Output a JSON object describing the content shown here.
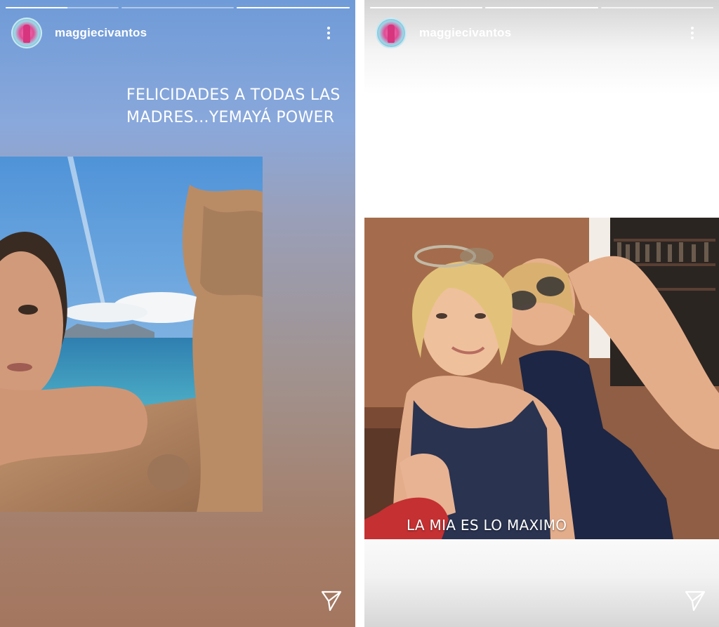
{
  "stories": [
    {
      "progress": [
        1,
        0,
        1
      ],
      "username": "maggiecivantos",
      "caption": "FELICIDADES A TODAS LAS MADRES...YEMAYÁ POWER"
    },
    {
      "progress": [
        1,
        1,
        0
      ],
      "username": "maggiecivantos",
      "photo_caption": "LA MIA ES LO MAXIMO"
    }
  ],
  "colors": {
    "left_bg_top": "#6f9bd8",
    "left_bg_bottom": "#a4765f",
    "right_bg": "#ffffff",
    "text": "#ffffff"
  },
  "icons": {
    "more": "more-vertical-icon",
    "send": "paper-plane-icon",
    "avatar": "profile-avatar"
  }
}
